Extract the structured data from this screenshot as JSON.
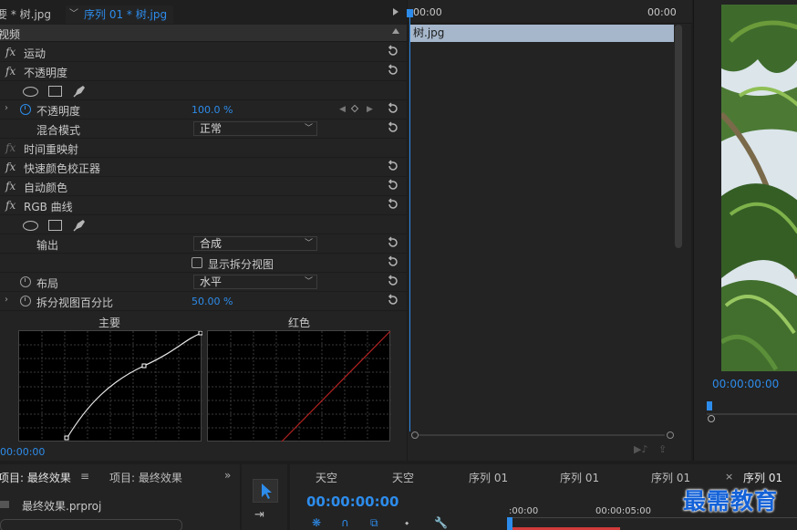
{
  "effect_controls": {
    "tab_master": "要 * 树.jpg",
    "tab_sequence": "序列 01 * 树.jpg",
    "section_video": "视频",
    "rows": {
      "motion": "运动",
      "opacity": "不透明度",
      "opacity_prop": "不透明度",
      "opacity_value": "100.0 %",
      "blend_mode": "混合模式",
      "blend_value": "正常",
      "time_remap": "时间重映射",
      "fast_color": "快速颜色校正器",
      "auto_color": "自动颜色",
      "rgb_curves": "RGB 曲线",
      "output": "输出",
      "output_value": "合成",
      "split_view": "显示拆分视图",
      "layout": "布局",
      "layout_value": "水平",
      "split_percent": "拆分视图百分比",
      "split_percent_value": "50.00 %"
    },
    "fx_symbol": "fx",
    "curve_main_label": "主要",
    "curve_red_label": "红色",
    "timecode": "00:00:00"
  },
  "mini_timeline": {
    "tc_start": "00:00",
    "tc_end": "00:00",
    "clip_name": "树.jpg"
  },
  "monitor": {
    "timecode": "00:00:00:00"
  },
  "project": {
    "tab_1": "项目: 最终效果",
    "tab_2": "项目: 最终效果",
    "more": "»",
    "file": "最终效果.prproj"
  },
  "timeline": {
    "tabs": [
      "天空",
      "天空",
      "序列 01",
      "序列 01",
      "序列 01",
      "序列 01"
    ],
    "close": "×",
    "timecode": "00:00:00:00",
    "ruler_0": ":00:00",
    "ruler_5": "00:00:05:00"
  },
  "watermark": "最需教育",
  "colors": {
    "accent_blue": "#2d8ceb",
    "clip_blue": "#a6b7cb",
    "panel_bg": "#232323",
    "curve_red": "#b22222"
  }
}
